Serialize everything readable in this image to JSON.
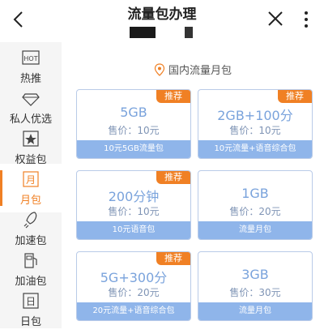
{
  "header": {
    "title": "流量包办理"
  },
  "sidebar": {
    "items": [
      {
        "label": "热推",
        "icon": "hot-icon"
      },
      {
        "label": "私人优选",
        "icon": "diamond-icon"
      },
      {
        "label": "权益包",
        "icon": "rights-icon"
      },
      {
        "label": "月包",
        "icon": "month-icon"
      },
      {
        "label": "加速包",
        "icon": "rocket-icon"
      },
      {
        "label": "加油包",
        "icon": "fuel-icon"
      },
      {
        "label": "日包",
        "icon": "day-icon"
      }
    ]
  },
  "section": {
    "title": "国内流量月包"
  },
  "cards": [
    {
      "badge": "推荐",
      "name": "5GB",
      "price": "售价：10元",
      "footer": "10元5GB流量包"
    },
    {
      "badge": "推荐",
      "name": "2GB+100分",
      "price": "售价：10元",
      "footer": "10元流量+语音综合包"
    },
    {
      "badge": "推荐",
      "name": "200分钟",
      "price": "售价：10元",
      "footer": "10元语音包"
    },
    {
      "badge": "",
      "name": "1GB",
      "price": "售价：20元",
      "footer": "流量月包"
    },
    {
      "badge": "推荐",
      "name": "5G+300分",
      "price": "售价：20元",
      "footer": "20元流量+语音综合包"
    },
    {
      "badge": "",
      "name": "3GB",
      "price": "售价：30元",
      "footer": "流量月包"
    }
  ],
  "colors": {
    "accent": "#f08024",
    "card_border": "#b9cbe8",
    "card_footer": "#8fb5ea",
    "card_text": "#7aa3dc"
  }
}
